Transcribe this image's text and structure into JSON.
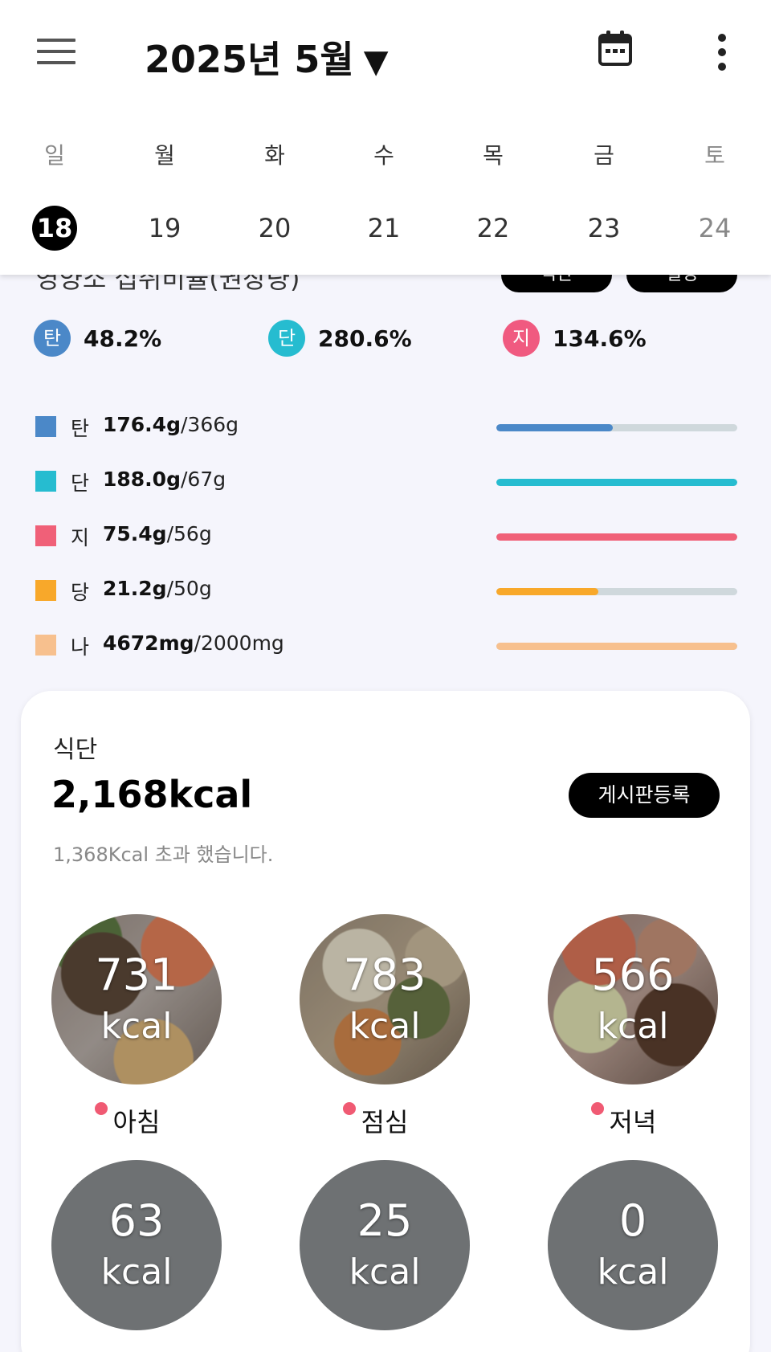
{
  "header": {
    "month_title": "2025년 5월",
    "dropdown_arrow": "▼",
    "weekdays": [
      "일",
      "월",
      "화",
      "수",
      "목",
      "금",
      "토"
    ],
    "dates": [
      "18",
      "19",
      "20",
      "21",
      "22",
      "23",
      "24"
    ],
    "selected_date": "18"
  },
  "nutrition": {
    "partial_title": "영양소 섭취비율(권장량)",
    "pill_left": "식단",
    "pill_right": "설정",
    "macro_percents": [
      {
        "letter": "탄",
        "value": "48.2%",
        "color": "#4b88c8"
      },
      {
        "letter": "단",
        "value": "280.6%",
        "color": "#26bcd0"
      },
      {
        "letter": "지",
        "value": "134.6%",
        "color": "#f05a80"
      }
    ],
    "rows": [
      {
        "name": "탄",
        "consumed": "176.4g",
        "target": "/366g",
        "color": "#4b88c8",
        "ratio": 0.482
      },
      {
        "name": "단",
        "consumed": "188.0g",
        "target": "/67g",
        "color": "#26bcd0",
        "ratio": 1.0
      },
      {
        "name": "지",
        "consumed": "75.4g",
        "target": "/56g",
        "color": "#f06078",
        "ratio": 1.0
      },
      {
        "name": "당",
        "consumed": "21.2g",
        "target": "/50g",
        "color": "#f8a82a",
        "ratio": 0.424
      },
      {
        "name": "나",
        "consumed": "4672mg",
        "target": "/2000mg",
        "color": "#f7c08e",
        "ratio": 1.0
      }
    ]
  },
  "diet": {
    "label": "식단",
    "total": "2,168kcal",
    "board_button": "게시판등록",
    "over_message": "1,368Kcal 초과 했습니다.",
    "meals": [
      {
        "value": "731",
        "unit": "kcal",
        "label": "아침"
      },
      {
        "value": "783",
        "unit": "kcal",
        "label": "점심"
      },
      {
        "value": "566",
        "unit": "kcal",
        "label": "저녁"
      }
    ],
    "snacks": [
      {
        "value": "63",
        "unit": "kcal"
      },
      {
        "value": "25",
        "unit": "kcal"
      },
      {
        "value": "0",
        "unit": "kcal"
      }
    ]
  }
}
